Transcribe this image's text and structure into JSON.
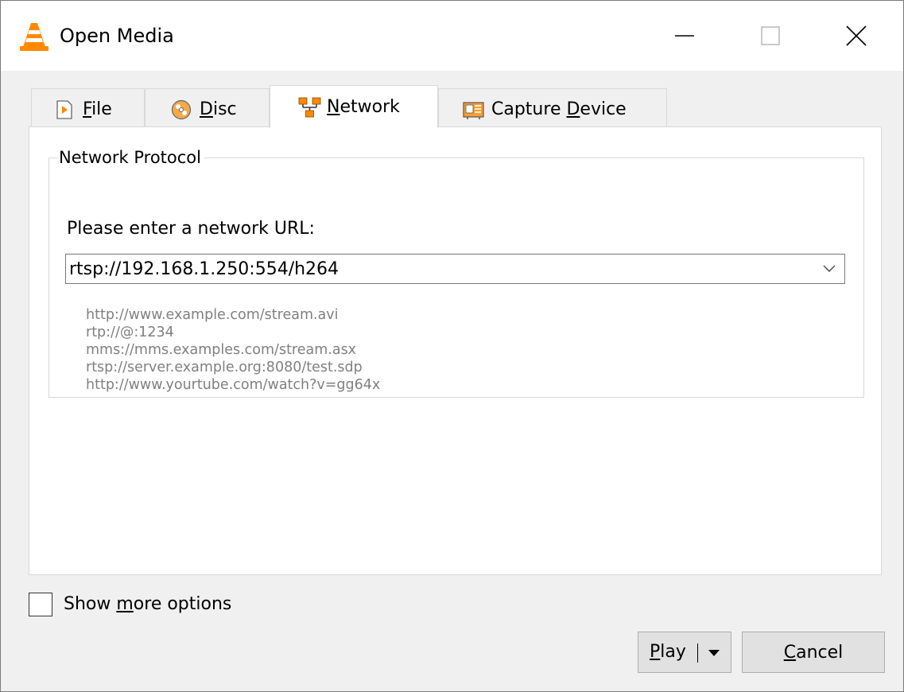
{
  "window": {
    "title": "Open Media",
    "controls": {
      "minimize": "minimize",
      "maximize": "maximize",
      "close": "close"
    }
  },
  "tabs": [
    {
      "id": "file",
      "accesskey": "F",
      "rest": "ile",
      "icon": "file-play-icon",
      "active": false
    },
    {
      "id": "disc",
      "accesskey": "D",
      "rest": "isc",
      "icon": "disc-icon",
      "active": false
    },
    {
      "id": "network",
      "accesskey": "N",
      "rest": "etwork",
      "icon": "network-icon",
      "active": true
    },
    {
      "id": "capture",
      "prefix": "Capture ",
      "accesskey": "D",
      "rest": "evice",
      "icon": "capture-card-icon",
      "active": false
    }
  ],
  "network": {
    "group_title": "Network Protocol",
    "url_label": "Please enter a network URL:",
    "url_value": "rtsp://192.168.1.250:554/h264",
    "examples": [
      "http://www.example.com/stream.avi",
      "rtp://@:1234",
      "mms://mms.examples.com/stream.asx",
      "rtsp://server.example.org:8080/test.sdp",
      "http://www.yourtube.com/watch?v=gg64x"
    ]
  },
  "options": {
    "show_more_prefix": "Show ",
    "show_more_key": "m",
    "show_more_rest": "ore options",
    "checked": false
  },
  "buttons": {
    "play_key": "P",
    "play_rest": "lay",
    "cancel_key": "C",
    "cancel_rest": "ancel"
  },
  "colors": {
    "accent_orange": "#ff8800",
    "hint_gray": "#808080",
    "border": "#d9d9d9"
  }
}
